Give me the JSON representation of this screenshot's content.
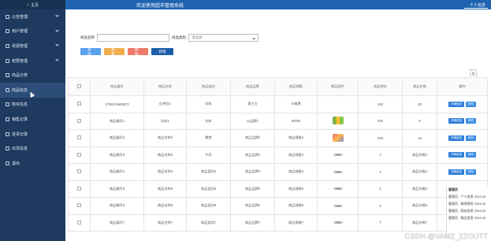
{
  "sidebar": {
    "home": "主页",
    "items": [
      {
        "label": "公告管理",
        "icon": "notice-icon",
        "expandable": true
      },
      {
        "label": "用户管理",
        "icon": "user-icon",
        "expandable": true
      },
      {
        "label": "资源管理",
        "icon": "folder-icon",
        "expandable": true
      },
      {
        "label": "权限管理",
        "icon": "lock-icon",
        "expandable": true
      },
      {
        "label": "商品分类",
        "icon": "category-icon",
        "expandable": false
      },
      {
        "label": "商品信息",
        "icon": "goods-icon",
        "expandable": false,
        "active": true
      },
      {
        "label": "购买信息",
        "icon": "cart-icon",
        "expandable": false
      },
      {
        "label": "销售记录",
        "icon": "sales-icon",
        "expandable": false
      },
      {
        "label": "进货记录",
        "icon": "stock-icon",
        "expandable": false
      },
      {
        "label": "出货信息",
        "icon": "ship-icon",
        "expandable": false
      },
      {
        "label": "退出",
        "icon": "logout-icon",
        "expandable": false
      }
    ]
  },
  "header": {
    "title": "欢迎使用超市管理系统",
    "user": "个人信息"
  },
  "search": {
    "name_label": "商品名称",
    "name_value": "",
    "category_label": "商品类别",
    "category_placeholder": "请选择"
  },
  "actions": {
    "query": "查询",
    "reset": "重置",
    "delete": "删除",
    "add": "新增"
  },
  "table": {
    "tools_icon": "print-icon",
    "headers": [
      "",
      "商品编号",
      "商品名称",
      "商品类别",
      "商品品牌",
      "商品规格",
      "商品图片",
      "商品库存",
      "商品价格",
      "操作"
    ],
    "rows": [
      {
        "code": "1705376609573",
        "name": "红茶饮1",
        "type": "饮料",
        "brand": "第三方",
        "spec": "水电费",
        "img": "none",
        "stock": "100",
        "price": "30"
      },
      {
        "code": "商品编号1",
        "name": "饮料1",
        "type": "饮料",
        "brand": "xx品牌1",
        "spec": "500ml",
        "img": "a",
        "stock": "400",
        "price": "6"
      },
      {
        "code": "商品编号2",
        "name": "商品名称2",
        "type": "零食",
        "brand": "商品品牌2",
        "spec": "商品规格2",
        "img": "b",
        "stock": "200",
        "price": "15"
      },
      {
        "code": "商品编号3",
        "name": "商品名称3",
        "type": "牛奶",
        "brand": "商品品牌3",
        "spec": "商品规格3",
        "img": "c",
        "stock": "3",
        "price": "商品价格3"
      },
      {
        "code": "商品编号4",
        "name": "商品名称4",
        "type": "商品类别4",
        "brand": "商品品牌4",
        "spec": "商品规格4",
        "img": "c",
        "stock": "4",
        "price": "商品价格4"
      },
      {
        "code": "商品编号5",
        "name": "商品名称5",
        "type": "商品类别5",
        "brand": "商品品牌5",
        "spec": "商品规格5",
        "img": "c",
        "stock": "5",
        "price": "商品价格5"
      },
      {
        "code": "商品编号6",
        "name": "商品名称6",
        "type": "商品类别6",
        "brand": "商品品牌6",
        "spec": "商品规格6",
        "img": "c",
        "stock": "6",
        "price": "商品价格6"
      },
      {
        "code": "商品编号7",
        "name": "商品名称7",
        "type": "商品类别7",
        "brand": "商品品牌7",
        "spec": "商品规格7",
        "img": "c",
        "stock": "7",
        "price": "商品价格7"
      }
    ],
    "op_view": "详情信息",
    "op_edit": "修改"
  },
  "popup": {
    "lines": [
      "管理员",
      "管理员 - 个人信息 2024.03",
      "管理员 - 修改密码 2024.03",
      "管理员 - 网站信息 2024.03",
      "管理员 - 商品信息 2024.03"
    ]
  },
  "watermark": "CSDN @VAMZ_ZZOUTT",
  "colors": {
    "sidebar": "#1e3a5f",
    "topbar": "#1f63b0",
    "query": "#5aa1ee",
    "reset": "#f0ad4e",
    "delete": "#f07a6a",
    "add": "#1d5fa8"
  }
}
